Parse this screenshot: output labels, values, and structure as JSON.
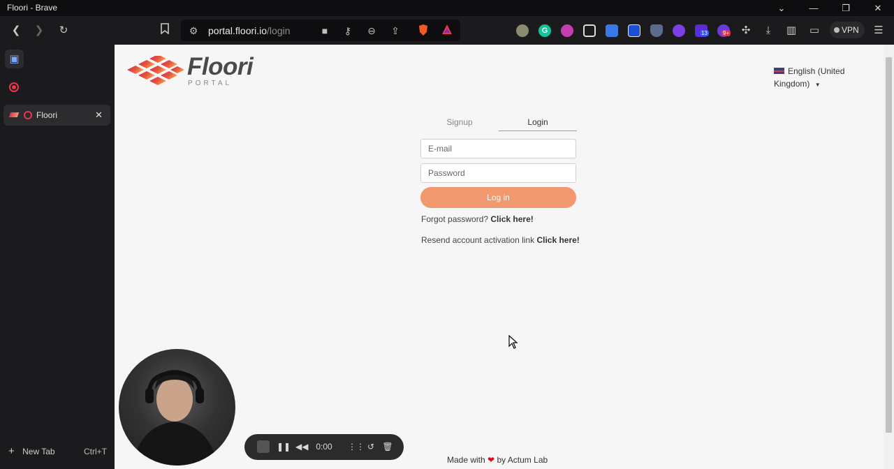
{
  "window": {
    "title": "Floori - Brave"
  },
  "toolbar": {
    "url_domain": "portal.floori.io",
    "url_path": "/login",
    "vpn_label": "VPN",
    "ext_badges": [
      "13",
      "9+"
    ]
  },
  "sidebar": {
    "tabs": [
      {
        "label": "Floori"
      }
    ],
    "new_tab_label": "New Tab",
    "new_tab_shortcut": "Ctrl+T"
  },
  "page": {
    "logo_text": "Floori",
    "logo_sub": "PORTAL",
    "language": "English (United Kingdom)",
    "tabs": [
      {
        "label": "Signup",
        "active": false
      },
      {
        "label": "Login",
        "active": true
      }
    ],
    "email_placeholder": "E-mail",
    "password_placeholder": "Password",
    "login_button": "Log in",
    "forgot_text": "Forgot password?",
    "forgot_link": "Click here!",
    "resend_text": "Resend account activation link",
    "resend_link": "Click here!",
    "footer_prefix": "Made with",
    "footer_suffix": "by Actum Lab"
  },
  "recorder": {
    "time": "0:00"
  },
  "colors": {
    "accent": "#f1986e",
    "tab_underline": "#e8833f"
  }
}
